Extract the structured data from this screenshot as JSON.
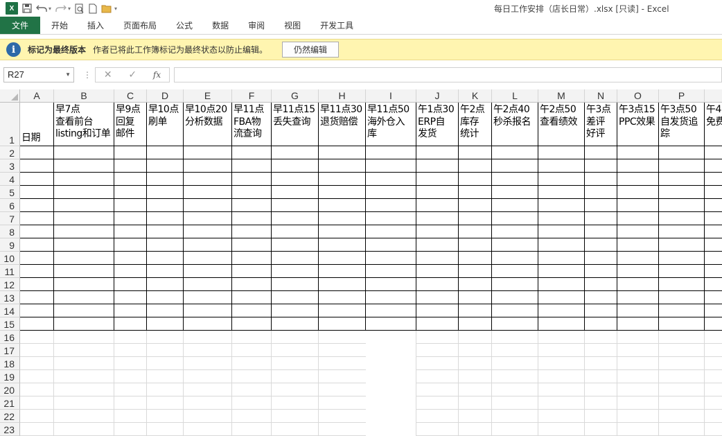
{
  "window": {
    "title": "每日工作安排（店长日常）.xlsx  [只读] - Excel",
    "app_icon_letter": "X"
  },
  "ribbon": {
    "tabs": [
      "文件",
      "开始",
      "插入",
      "页面布局",
      "公式",
      "数据",
      "审阅",
      "视图",
      "开发工具"
    ]
  },
  "infobar": {
    "title": "标记为最终版本",
    "message": "作者已将此工作簿标记为最终状态以防止编辑。",
    "button": "仍然编辑"
  },
  "formula_bar": {
    "name_box": "R27",
    "fx_label": "fx",
    "cancel_symbol": "✕",
    "enter_symbol": "✓",
    "value": ""
  },
  "sheet": {
    "columns": [
      "A",
      "B",
      "C",
      "D",
      "E",
      "F",
      "G",
      "H",
      "I",
      "J",
      "K",
      "L",
      "M",
      "N",
      "O",
      "P",
      ""
    ],
    "rows": [
      "1",
      "2",
      "3",
      "4",
      "5",
      "6",
      "7",
      "8",
      "9",
      "10",
      "11",
      "12",
      "13",
      "14",
      "15",
      "16",
      "17",
      "18",
      "19",
      "20",
      "21",
      "22",
      "23"
    ],
    "header_row": [
      "日期",
      "早7点\n查看前台\nlisting和订单",
      "早9点\n回复\n邮件",
      "早10点\n刷单",
      "早10点20\n分析数据",
      "早11点\nFBA物\n流查询",
      "早11点15\n丢失查询",
      "早11点30\n退货赔偿",
      "早11点50\n海外仓入\n库",
      "午1点30\nERP自\n发货",
      "午2点\n库存\n统计",
      "午2点40\n秒杀报名",
      "午2点50\n查看绩效",
      "午3点\n差评\n好评",
      "午3点15\nPPC效果",
      "午3点50\n自发货追\n踪",
      "午4\n免费"
    ]
  },
  "colors": {
    "excel_green": "#217346",
    "info_bg": "#fff5b0",
    "info_icon": "#2e69a8"
  }
}
